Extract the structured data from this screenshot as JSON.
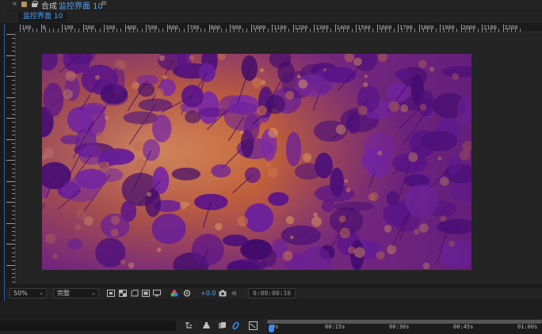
{
  "panel": {
    "close_glyph": "×",
    "title_prefix": "合成",
    "comp_name": "监控界面 10",
    "menu_glyph": "≡",
    "breadcrumb": "监控界面 10"
  },
  "ruler": {
    "top_labels": [
      "100",
      "0",
      "100",
      "200",
      "300",
      "400",
      "500",
      "600",
      "700",
      "800",
      "900",
      "1000",
      "1100",
      "1200",
      "1300",
      "1400",
      "1500",
      "1600",
      "1700",
      "1800",
      "1900",
      "2000",
      "2100",
      "2200"
    ]
  },
  "viewer_toolbar": {
    "zoom": "50%",
    "resolution": "完整",
    "exposure": "+0.0",
    "timecode": "0:00:00:16",
    "icons": [
      "region-of-interest-icon",
      "transparency-grid-icon",
      "mask-path-icon",
      "safe-margins-icon",
      "channel-icon",
      "color-management-icon",
      "exposure-reset-icon",
      "snapshot-icon",
      "show-snapshot-icon"
    ]
  },
  "timeline": {
    "time_labels": [
      "0s",
      "00:15s",
      "00:30s",
      "00:45s",
      "01:00s"
    ],
    "icons": [
      "shy-layers-icon",
      "frame-blending-icon",
      "motion-blur-icon",
      "graph-editor-icon",
      "composition-mini-flowchart-icon"
    ]
  },
  "colors": {
    "accent": "#4ea4ff",
    "panel_bg": "#232323",
    "viewer_bg": "#242424",
    "comp_warm": "#d98a4a",
    "comp_purple": "#5b138a"
  }
}
